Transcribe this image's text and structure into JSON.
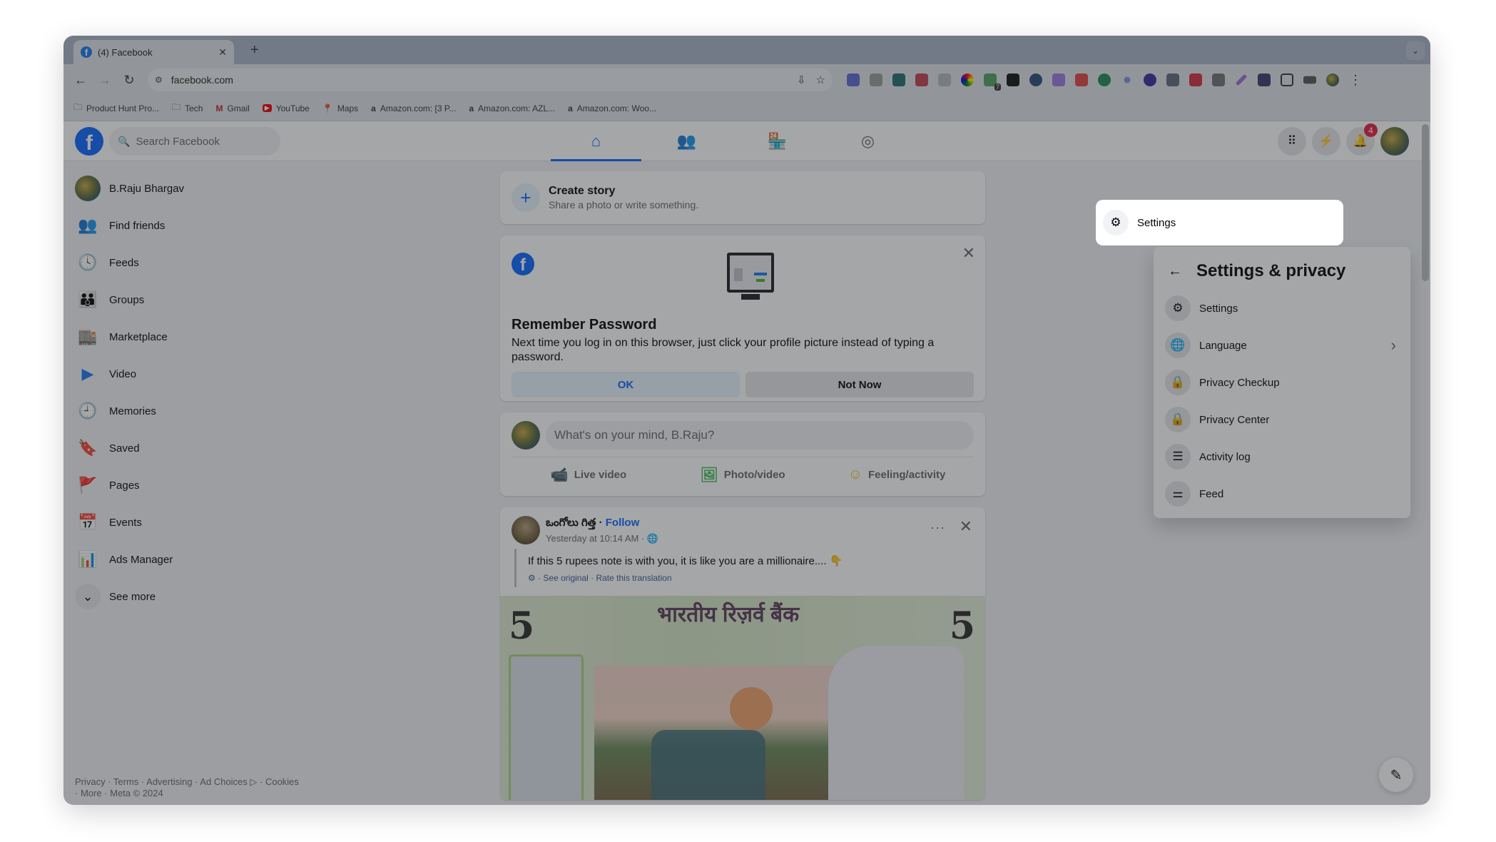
{
  "browser": {
    "tab_title": "(4) Facebook",
    "tab_close": "✕",
    "new_tab": "+",
    "tab_search": "⌄",
    "back": "←",
    "forward": "→",
    "reload": "↻",
    "site_settings": "⚙",
    "url": "facebook.com",
    "install_icon": "⇩",
    "star_icon": "☆",
    "menu_icon": "⋮",
    "extensions_badge": "7",
    "bookmarks": [
      {
        "icon": "🗀",
        "label": "Product Hunt Pro..."
      },
      {
        "icon": "🗀",
        "label": "Tech"
      },
      {
        "icon": "M",
        "label": "Gmail"
      },
      {
        "icon": "▶",
        "label": "YouTube"
      },
      {
        "icon": "📍",
        "label": "Maps"
      },
      {
        "icon": "a",
        "label": "Amazon.com: [3 P..."
      },
      {
        "icon": "a",
        "label": "Amazon.com: AZL..."
      },
      {
        "icon": "a",
        "label": "Amazon.com: Woo..."
      }
    ]
  },
  "header": {
    "logo": "f",
    "search_placeholder": "Search Facebook",
    "search_icon": "🔍",
    "nav_tabs": [
      {
        "name": "home",
        "icon": "⌂",
        "active": true
      },
      {
        "name": "friends",
        "icon": "👥",
        "active": false
      },
      {
        "name": "marketplace",
        "icon": "🏪",
        "active": false
      },
      {
        "name": "groups",
        "icon": "◎",
        "active": false
      }
    ],
    "menu_icon": "⠿",
    "messenger_icon": "⚡",
    "notifications_icon": "🔔",
    "notifications_count": "4"
  },
  "sidebar": {
    "items": [
      {
        "label": "B.Raju Bhargav",
        "icon": ""
      },
      {
        "label": "Find friends",
        "icon": "👥"
      },
      {
        "label": "Feeds",
        "icon": "🕓"
      },
      {
        "label": "Groups",
        "icon": "👪"
      },
      {
        "label": "Marketplace",
        "icon": "🏬"
      },
      {
        "label": "Video",
        "icon": "▶"
      },
      {
        "label": "Memories",
        "icon": "🕘"
      },
      {
        "label": "Saved",
        "icon": "🔖"
      },
      {
        "label": "Pages",
        "icon": "🚩"
      },
      {
        "label": "Events",
        "icon": "📅"
      },
      {
        "label": "Ads Manager",
        "icon": "📊"
      },
      {
        "label": "See more",
        "icon": "⌄"
      }
    ],
    "footer_line1": "Privacy · Terms · Advertising · Ad Choices ▷ · Cookies",
    "footer_line2": "· More · Meta © 2024"
  },
  "feed": {
    "story": {
      "plus": "+",
      "title": "Create story",
      "subtitle": "Share a photo or write something."
    },
    "remember_password": {
      "logo": "f",
      "close": "✕",
      "title": "Remember Password",
      "body": "Next time you log in on this browser, just click your profile picture instead of typing a password.",
      "ok_label": "OK",
      "not_now_label": "Not Now"
    },
    "composer": {
      "placeholder": "What's on your mind, B.Raju?",
      "actions": [
        {
          "icon": "📹",
          "label": "Live video",
          "color": "#e42645"
        },
        {
          "icon": "🖼",
          "label": "Photo/video",
          "color": "#45bd62"
        },
        {
          "icon": "☺",
          "label": "Feeling/activity",
          "color": "#f7b928"
        }
      ]
    },
    "post": {
      "author": "ఒంగోలు గిత్త",
      "separator": " · ",
      "follow": "Follow",
      "time": "Yesterday at 10:14 AM · 🌐",
      "menu": "···",
      "close": "✕",
      "text": "If this 5 rupees note is with you, it is like you are a millionaire.... 👇",
      "translation": "⚙ · See original · Rate this translation",
      "image": {
        "denomination": "5",
        "bank_text": "भारतीय रिज़र्व बैंक"
      }
    }
  },
  "settings_menu": {
    "back": "←",
    "title": "Settings & privacy",
    "items": [
      {
        "icon": "⚙",
        "label": "Settings",
        "highlighted": true
      },
      {
        "icon": "🌐",
        "label": "Language",
        "chevron": "›"
      },
      {
        "icon": "🔒",
        "label": "Privacy Checkup"
      },
      {
        "icon": "🔒",
        "label": "Privacy Center"
      },
      {
        "icon": "☰",
        "label": "Activity log"
      },
      {
        "icon": "⚌",
        "label": "Feed"
      }
    ]
  },
  "compose_fab_icon": "✎",
  "colors": {
    "brand": "#0866ff",
    "badge": "#e41e3f",
    "overlay": "rgba(40,42,46,0.42)"
  }
}
